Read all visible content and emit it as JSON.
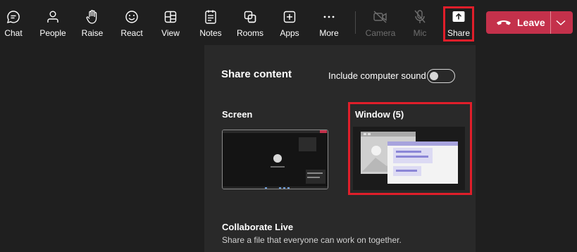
{
  "toolbar": {
    "items": [
      {
        "label": "Chat",
        "icon": "chat-icon"
      },
      {
        "label": "People",
        "icon": "people-icon"
      },
      {
        "label": "Raise",
        "icon": "raise-hand-icon"
      },
      {
        "label": "React",
        "icon": "react-icon"
      },
      {
        "label": "View",
        "icon": "view-icon"
      },
      {
        "label": "Notes",
        "icon": "notes-icon"
      },
      {
        "label": "Rooms",
        "icon": "rooms-icon"
      },
      {
        "label": "Apps",
        "icon": "apps-icon"
      },
      {
        "label": "More",
        "icon": "more-icon"
      },
      {
        "label": "Camera",
        "icon": "camera-off-icon",
        "disabled": true
      },
      {
        "label": "Mic",
        "icon": "mic-off-icon",
        "disabled": true
      },
      {
        "label": "Share",
        "icon": "share-icon",
        "highlighted": true
      }
    ],
    "leave_label": "Leave",
    "leave_color": "#c4314b"
  },
  "share_panel": {
    "title": "Share content",
    "sound_label": "Include computer sound",
    "sound_on": false,
    "screen_label": "Screen",
    "window_label": "Window (5)",
    "collab_title": "Collaborate Live",
    "collab_desc": "Share a file that everyone can work on together."
  },
  "colors": {
    "highlight": "#e01e2a",
    "background": "#1f1f1f",
    "panel": "#292929"
  }
}
